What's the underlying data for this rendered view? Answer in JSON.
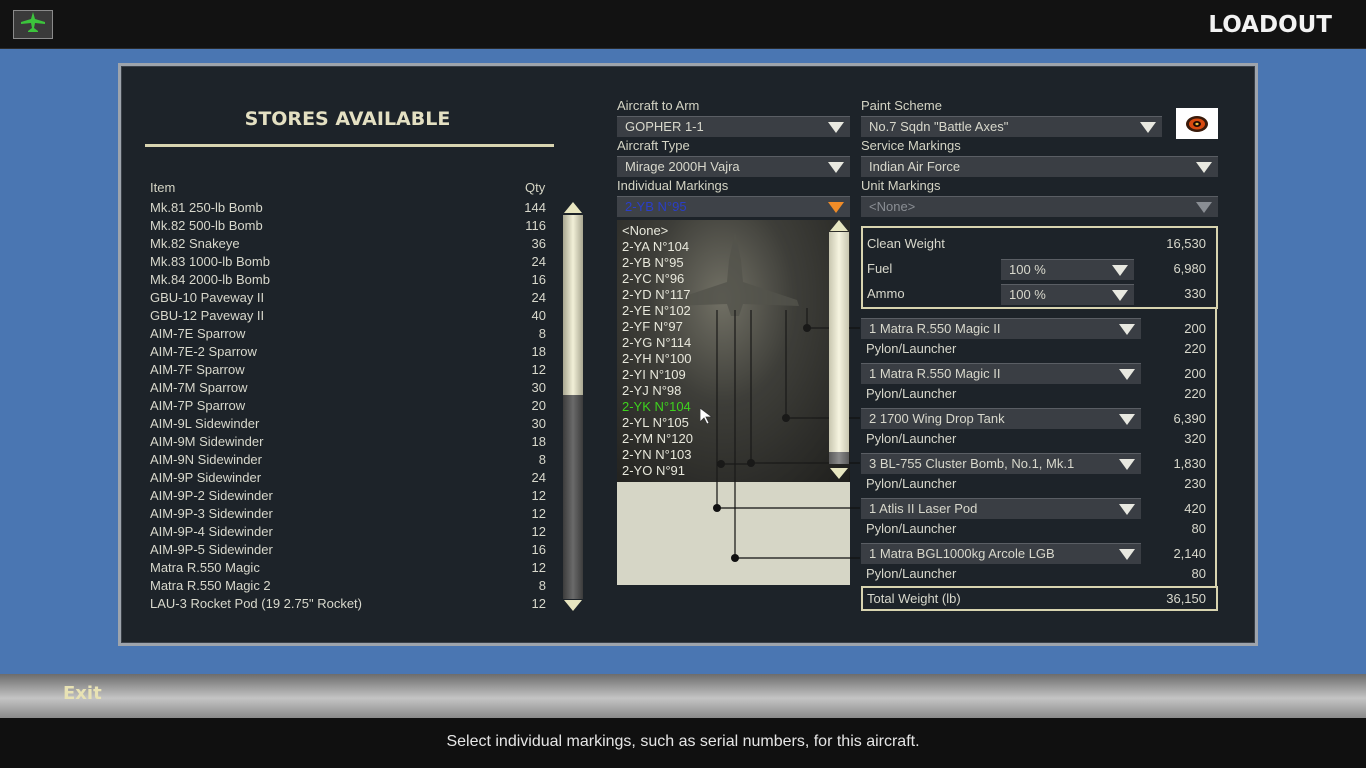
{
  "header": {
    "title": "LOADOUT",
    "home_icon": "aircraft-icon"
  },
  "stores": {
    "title": "STORES AVAILABLE",
    "col_item": "Item",
    "col_qty": "Qty",
    "items": [
      {
        "name": "Mk.81 250-lb Bomb",
        "qty": "144"
      },
      {
        "name": "Mk.82 500-lb Bomb",
        "qty": "116"
      },
      {
        "name": "Mk.82 Snakeye",
        "qty": "36"
      },
      {
        "name": "Mk.83 1000-lb Bomb",
        "qty": "24"
      },
      {
        "name": "Mk.84 2000-lb Bomb",
        "qty": "16"
      },
      {
        "name": "GBU-10 Paveway II",
        "qty": "24"
      },
      {
        "name": "GBU-12 Paveway II",
        "qty": "40"
      },
      {
        "name": "AIM-7E Sparrow",
        "qty": "8"
      },
      {
        "name": "AIM-7E-2 Sparrow",
        "qty": "18"
      },
      {
        "name": "AIM-7F Sparrow",
        "qty": "12"
      },
      {
        "name": "AIM-7M Sparrow",
        "qty": "30"
      },
      {
        "name": "AIM-7P Sparrow",
        "qty": "20"
      },
      {
        "name": "AIM-9L Sidewinder",
        "qty": "30"
      },
      {
        "name": "AIM-9M Sidewinder",
        "qty": "18"
      },
      {
        "name": "AIM-9N Sidewinder",
        "qty": "8"
      },
      {
        "name": "AIM-9P Sidewinder",
        "qty": "24"
      },
      {
        "name": "AIM-9P-2 Sidewinder",
        "qty": "12"
      },
      {
        "name": "AIM-9P-3 Sidewinder",
        "qty": "12"
      },
      {
        "name": "AIM-9P-4 Sidewinder",
        "qty": "12"
      },
      {
        "name": "AIM-9P-5 Sidewinder",
        "qty": "16"
      },
      {
        "name": "Matra R.550 Magic",
        "qty": "12"
      },
      {
        "name": "Matra R.550 Magic 2",
        "qty": "8"
      },
      {
        "name": "LAU-3 Rocket Pod (19 2.75\" Rocket)",
        "qty": "12"
      }
    ]
  },
  "config": {
    "aircraft_to_arm_label": "Aircraft to Arm",
    "aircraft_to_arm": "GOPHER 1-1",
    "aircraft_type_label": "Aircraft Type",
    "aircraft_type": "Mirage 2000H Vajra",
    "individual_markings_label": "Individual Markings",
    "individual_markings": "2-YB N°95",
    "paint_scheme_label": "Paint Scheme",
    "paint_scheme": "No.7 Sqdn \"Battle Axes\"",
    "service_markings_label": "Service Markings",
    "service_markings": "Indian Air Force",
    "unit_markings_label": "Unit Markings",
    "unit_markings": "<None>"
  },
  "markings_list": {
    "options": [
      "<None>",
      "2-YA N°104",
      "2-YB N°95",
      "2-YC N°96",
      "2-YD N°117",
      "2-YE N°102",
      "2-YF N°97",
      "2-YG N°114",
      "2-YH N°100",
      "2-YI N°109",
      "2-YJ N°98",
      "2-YK N°104",
      "2-YL N°105",
      "2-YM N°120",
      "2-YN N°103",
      "2-YO N°91"
    ],
    "highlighted": "2-YK N°104"
  },
  "weights": {
    "clean_weight_label": "Clean Weight",
    "clean_weight": "16,530",
    "fuel_label": "Fuel",
    "fuel_pct": "100 %",
    "fuel_weight": "6,980",
    "ammo_label": "Ammo",
    "ammo_pct": "100 %",
    "ammo_weight": "330",
    "total_label": "Total Weight (lb)",
    "total": "36,150"
  },
  "stations": [
    {
      "store": "1 Matra R.550 Magic II",
      "store_weight": "200",
      "pylon": "Pylon/Launcher",
      "pylon_weight": "220"
    },
    {
      "store": "1 Matra R.550 Magic II",
      "store_weight": "200",
      "pylon": "Pylon/Launcher",
      "pylon_weight": "220"
    },
    {
      "store": "2 1700 Wing Drop Tank",
      "store_weight": "6,390",
      "pylon": "Pylon/Launcher",
      "pylon_weight": "320"
    },
    {
      "store": "3 BL-755 Cluster Bomb, No.1, Mk.1",
      "store_weight": "1,830",
      "pylon": "Pylon/Launcher",
      "pylon_weight": "230"
    },
    {
      "store": "1 Atlis II Laser Pod",
      "store_weight": "420",
      "pylon": "Pylon/Launcher",
      "pylon_weight": "80"
    },
    {
      "store": "1 Matra BGL1000kg Arcole LGB",
      "store_weight": "2,140",
      "pylon": "Pylon/Launcher",
      "pylon_weight": "80"
    }
  ],
  "footer": {
    "exit_label": "Exit",
    "status": "Select individual markings, such as serial numbers, for this aircraft."
  },
  "colors": {
    "background_blue": "#4a76b2",
    "panel": "#1d2329",
    "accent_cream": "#d8d4b0",
    "highlight_green": "#3ed21e",
    "active_blue_text": "#2a3ec8",
    "active_arrow_orange": "#f08c28"
  }
}
